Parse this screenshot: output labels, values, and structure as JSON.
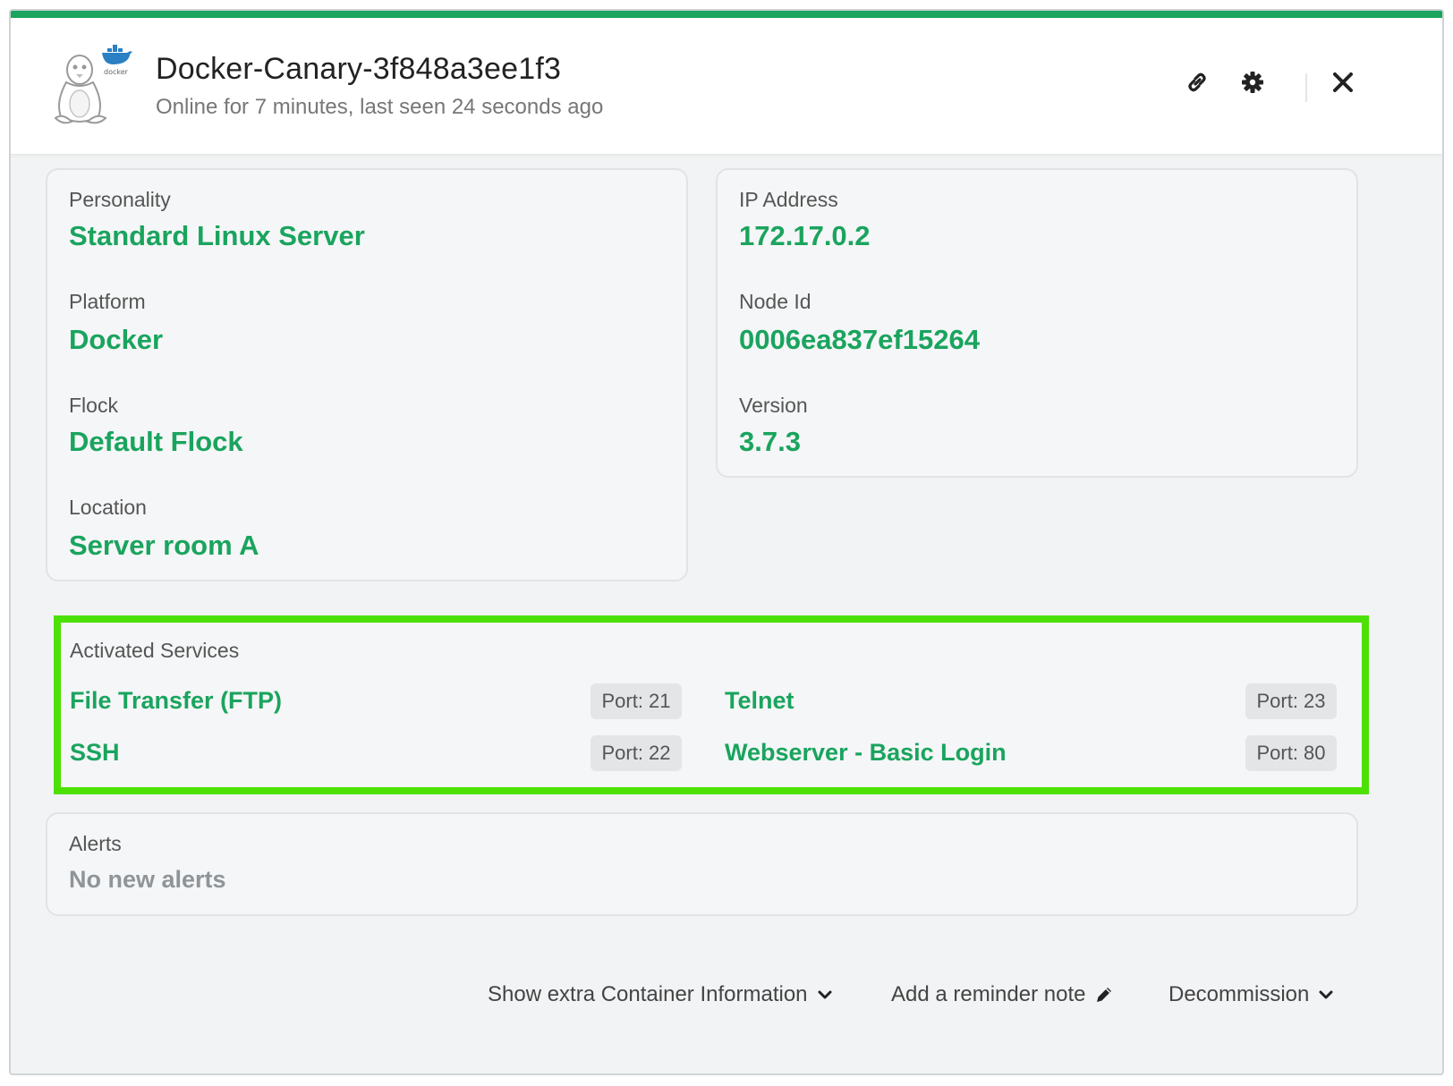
{
  "header": {
    "title": "Docker-Canary-3f848a3ee1f3",
    "subtitle": "Online for 7 minutes, last seen 24 seconds ago",
    "logo_text": "docker",
    "icons": [
      "linux-penguin-icon",
      "docker-whale-icon",
      "link-icon",
      "gear-icon",
      "close-icon"
    ]
  },
  "details_left": [
    {
      "label": "Personality",
      "value": "Standard Linux Server"
    },
    {
      "label": "Platform",
      "value": "Docker"
    },
    {
      "label": "Flock",
      "value": "Default Flock"
    },
    {
      "label": "Location",
      "value": "Server room A"
    }
  ],
  "details_right": [
    {
      "label": "IP Address",
      "value": "172.17.0.2"
    },
    {
      "label": "Node Id",
      "value": "0006ea837ef15264"
    },
    {
      "label": "Version",
      "value": "3.7.3"
    }
  ],
  "services": {
    "label": "Activated Services",
    "items": [
      {
        "name": "File Transfer (FTP)",
        "port": "Port: 21"
      },
      {
        "name": "Telnet",
        "port": "Port: 23"
      },
      {
        "name": "SSH",
        "port": "Port: 22"
      },
      {
        "name": "Webserver - Basic Login",
        "port": "Port: 80"
      }
    ]
  },
  "alerts": {
    "label": "Alerts",
    "value": "No new alerts"
  },
  "footer": {
    "extra_info": "Show extra Container Information",
    "reminder": "Add a reminder note",
    "decommission": "Decommission"
  },
  "colors": {
    "accent": "#1aa45e",
    "highlight": "#4de004",
    "background": "#f2f3f4"
  }
}
